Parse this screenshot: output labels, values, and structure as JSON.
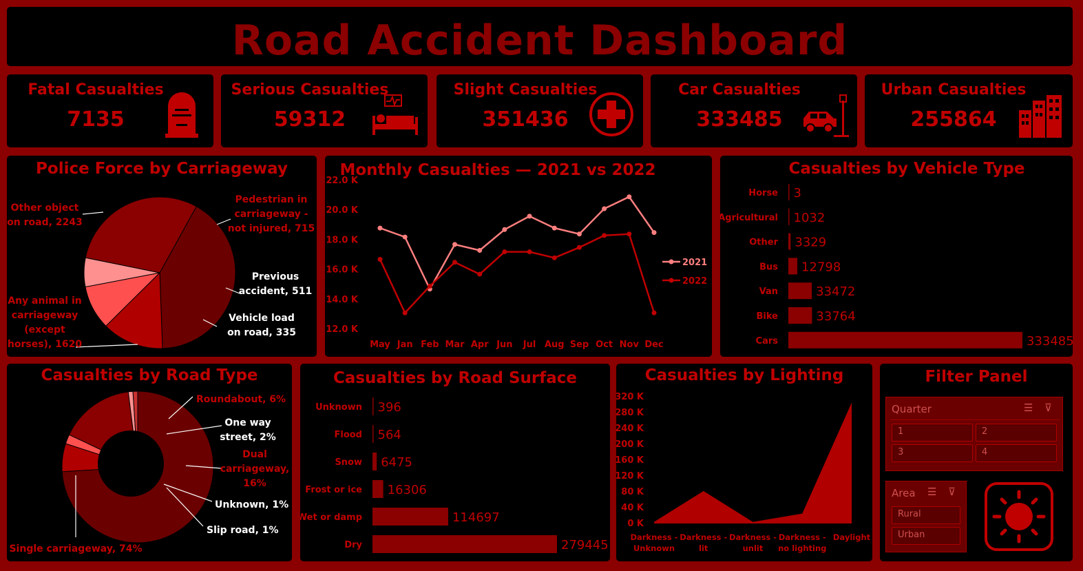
{
  "title": "Road Accident Dashboard",
  "kpis": [
    {
      "label": "Fatal Casualties",
      "value": "7135",
      "icon": "tombstone-icon"
    },
    {
      "label": "Serious Casualties",
      "value": "59312",
      "icon": "hospital-bed-icon"
    },
    {
      "label": "Slight Casualties",
      "value": "351436",
      "icon": "first-aid-cross-icon"
    },
    {
      "label": "Car Casualties",
      "value": "333485",
      "icon": "car-crash-icon"
    },
    {
      "label": "Urban Casualties",
      "value": "255864",
      "icon": "city-buildings-icon"
    }
  ],
  "colors": {
    "background": "#8b0000",
    "panel": "#000000",
    "text": "#c00000",
    "line2021": "#ff7f7f",
    "line2022": "#c00000",
    "bar": "#8b0000"
  },
  "chart_data": [
    {
      "id": "police_force",
      "type": "pie",
      "title": "Police Force by Carriageway",
      "slices": [
        {
          "label": "Other object on road, 2243",
          "value": 2243,
          "color": "#6b0000"
        },
        {
          "label": "Pedestrian in carriageway - not injured, 715",
          "value": 715,
          "color": "#b00000"
        },
        {
          "label": "Previous accident, 511",
          "value": 511,
          "color": "#ff5050"
        },
        {
          "label": "Vehicle load on road, 335",
          "value": 335,
          "color": "#ff9090"
        },
        {
          "label": "Any animal in carriageway (except horses), 1620",
          "value": 1620,
          "color": "#8b0000"
        }
      ]
    },
    {
      "id": "monthly",
      "type": "line",
      "title": "Monthly Casualties — 2021 vs 2022",
      "categories": [
        "May",
        "Jan",
        "Feb",
        "Mar",
        "Apr",
        "Jun",
        "Jul",
        "Aug",
        "Sep",
        "Oct",
        "Nov",
        "Dec"
      ],
      "yticks": [
        "12.0 K",
        "14.0 K",
        "16.0 K",
        "18.0 K",
        "20.0 K",
        "22.0 K"
      ],
      "ylim": [
        12000,
        22000
      ],
      "series": [
        {
          "name": "2021",
          "color": "#ff7f7f",
          "values": [
            18800,
            18200,
            14700,
            17700,
            17300,
            18700,
            19600,
            18800,
            18400,
            20100,
            20900,
            18500
          ]
        },
        {
          "name": "2022",
          "color": "#c00000",
          "values": [
            16700,
            13100,
            14900,
            16500,
            15700,
            17200,
            17200,
            16800,
            17500,
            18300,
            18400,
            13100
          ]
        }
      ]
    },
    {
      "id": "vehicle_type",
      "type": "bar",
      "orientation": "horizontal",
      "title": "Casualties by Vehicle Type",
      "categories": [
        "Horse",
        "Agricultural",
        "Other",
        "Bus",
        "Van",
        "Bike",
        "Cars"
      ],
      "values": [
        3,
        1032,
        3329,
        12798,
        33472,
        33764,
        333485
      ],
      "value_labels": [
        "3",
        "1032",
        "3329",
        "12798",
        "33472",
        "33764",
        "333485"
      ]
    },
    {
      "id": "road_type",
      "type": "pie",
      "title": "Casualties by Road Type",
      "slices": [
        {
          "label": "Single carriageway, 74%",
          "value": 74,
          "color": "#6b0000"
        },
        {
          "label": "Roundabout, 6%",
          "value": 6,
          "color": "#b00000"
        },
        {
          "label": "One way street, 2%",
          "value": 2,
          "color": "#ff5050"
        },
        {
          "label": "Dual carriageway, 16%",
          "value": 16,
          "color": "#8b0000"
        },
        {
          "label": "Unknown, 1%",
          "value": 1,
          "color": "#ff9090"
        },
        {
          "label": "Slip road, 1%",
          "value": 1,
          "color": "#c83030"
        }
      ]
    },
    {
      "id": "road_surface",
      "type": "bar",
      "orientation": "horizontal",
      "title": "Casualties by Road Surface",
      "categories": [
        "Unknown",
        "Flood",
        "Snow",
        "Frost or ice",
        "Wet or damp",
        "Dry"
      ],
      "values": [
        396,
        564,
        6475,
        16306,
        114697,
        279445
      ],
      "value_labels": [
        "396",
        "564",
        "6475",
        "16306",
        "114697",
        "279445"
      ]
    },
    {
      "id": "lighting",
      "type": "area",
      "title": "Casualties by Lighting",
      "categories": [
        "Darkness - Unknown",
        "Darkness - lit",
        "Darkness - unlit",
        "Darkness - no lighting",
        "Daylight"
      ],
      "values": [
        4000,
        82000,
        4000,
        25000,
        305000
      ],
      "yticks": [
        "0 K",
        "40 K",
        "80 K",
        "120 K",
        "160 K",
        "200 K",
        "240 K",
        "280 K",
        "320 K"
      ],
      "ylim": [
        0,
        320000
      ]
    }
  ],
  "filter": {
    "title": "Filter Panel",
    "quarter_label": "Quarter",
    "quarters": [
      "1",
      "2",
      "3",
      "4"
    ],
    "area_label": "Area",
    "areas": [
      "Rural",
      "Urban"
    ]
  }
}
